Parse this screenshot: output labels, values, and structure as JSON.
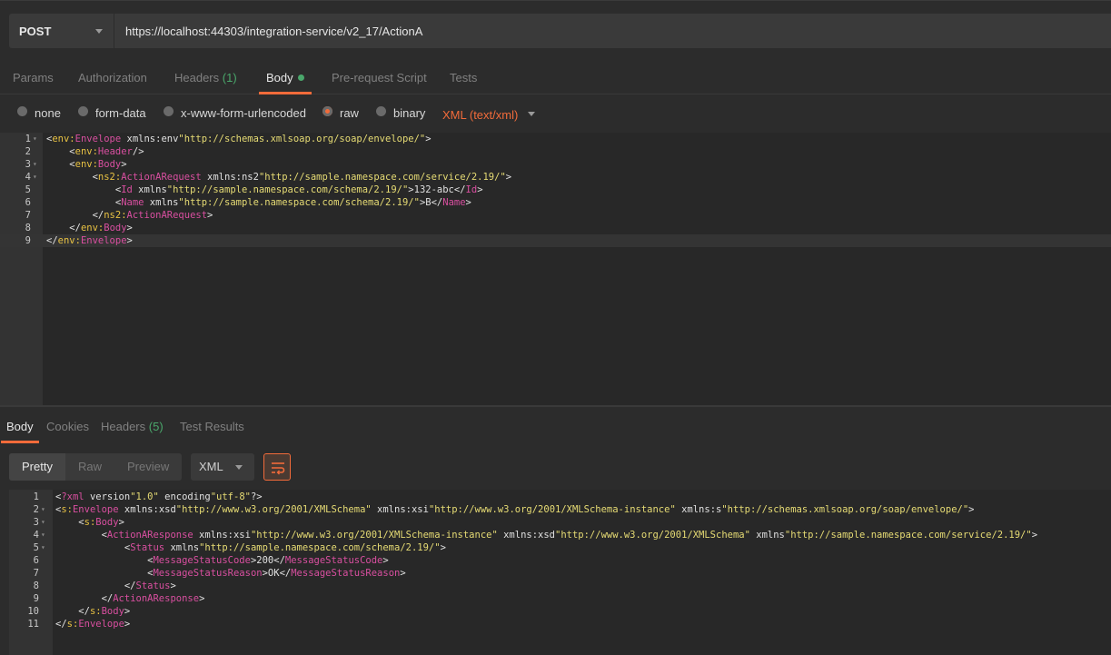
{
  "request": {
    "method": "POST",
    "url": "https://localhost:44303/integration-service/v2_17/ActionA"
  },
  "req_tabs": [
    {
      "label": "Params",
      "count": ""
    },
    {
      "label": "Authorization",
      "count": ""
    },
    {
      "label": "Headers",
      "count": "(1)"
    },
    {
      "label": "Body",
      "count": ""
    },
    {
      "label": "Pre-request Script",
      "count": ""
    },
    {
      "label": "Tests",
      "count": ""
    }
  ],
  "body_types": [
    "none",
    "form-data",
    "x-www-form-urlencoded",
    "raw",
    "binary"
  ],
  "body_content_type": "XML (text/xml)",
  "request_body": {
    "line_numbers": [
      "1",
      "2",
      "3",
      "4",
      "5",
      "6",
      "7",
      "8",
      "9"
    ],
    "lines": [
      "<env:Envelope xmlns:env=\"http://schemas.xmlsoap.org/soap/envelope/\">",
      "    <env:Header/>",
      "    <env:Body>",
      "        <ns2:ActionARequest xmlns:ns2=\"http://sample.namespace.com/service/2.19/\">",
      "            <Id xmlns=\"http://sample.namespace.com/schema/2.19/\">132-abc</Id>",
      "            <Name xmlns=\"http://sample.namespace.com/schema/2.19/\">B</Name>",
      "        </ns2:ActionARequest>",
      "    </env:Body>",
      "</env:Envelope>"
    ]
  },
  "resp_tabs": [
    {
      "label": "Body",
      "count": ""
    },
    {
      "label": "Cookies",
      "count": ""
    },
    {
      "label": "Headers",
      "count": "(5)"
    },
    {
      "label": "Test Results",
      "count": ""
    }
  ],
  "view_modes": [
    "Pretty",
    "Raw",
    "Preview"
  ],
  "response_format": "XML",
  "response_body": {
    "line_numbers": [
      "1",
      "2",
      "3",
      "4",
      "5",
      "6",
      "7",
      "8",
      "9",
      "10",
      "11"
    ],
    "lines": [
      "<?xml version=\"1.0\" encoding=\"utf-8\"?>",
      "<s:Envelope xmlns:xsd=\"http://www.w3.org/2001/XMLSchema\" xmlns:xsi=\"http://www.w3.org/2001/XMLSchema-instance\" xmlns:s=\"http://schemas.xmlsoap.org/soap/envelope/\">",
      "    <s:Body>",
      "        <ActionAResponse xmlns:xsi=\"http://www.w3.org/2001/XMLSchema-instance\" xmlns:xsd=\"http://www.w3.org/2001/XMLSchema\" xmlns=\"http://sample.namespace.com/service/2.19/\">",
      "            <Status xmlns=\"http://sample.namespace.com/schema/2.19/\">",
      "                <MessageStatusCode>200</MessageStatusCode>",
      "                <MessageStatusReason>OK</MessageStatusReason>",
      "            </Status>",
      "        </ActionAResponse>",
      "    </s:Body>",
      "</s:Envelope>"
    ]
  },
  "colors": {
    "accent": "#f26b3a",
    "count_green": "#4aa76b"
  }
}
